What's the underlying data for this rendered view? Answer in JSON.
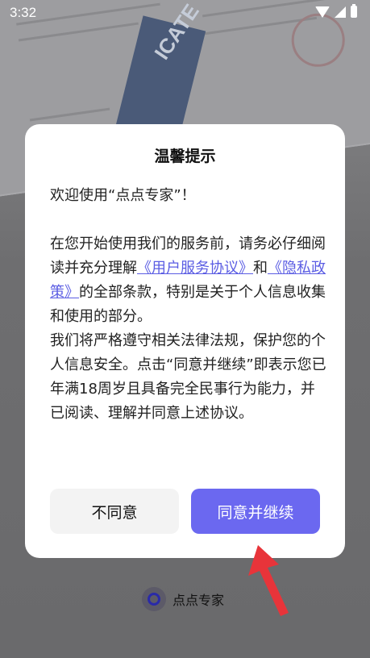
{
  "status_bar": {
    "time": "3:32"
  },
  "dialog": {
    "title": "温馨提示",
    "welcome": "欢迎使用“点点专家”！",
    "para1_prefix": "在您开始使用我们的服务前，请务必仔细阅读并充分理解",
    "link_user_agreement": "《用户服务协议》",
    "para1_and": "和",
    "link_privacy_policy": "《隐私政策》",
    "para1_suffix": "的全部条款，特别是关于个人信息收集和使用的部分。",
    "para2": "我们将严格遵守相关法律法规，保护您的个人信息安全。点击“同意并继续”即表示您已年满18周岁且具备完全民事行为能力，并已阅读、理解并同意上述协议。",
    "disagree_label": "不同意",
    "agree_label": "同意并继续"
  },
  "background": {
    "certificate_text": "ICATE"
  },
  "brand": {
    "name": "点点专家"
  },
  "colors": {
    "accent": "#6b68f0",
    "link": "#5b5de3",
    "annotation_arrow": "#e8343a"
  },
  "icons": [
    "wifi-icon",
    "signal-icon",
    "battery-icon",
    "arrow-annotation-icon",
    "brand-logo-icon"
  ]
}
